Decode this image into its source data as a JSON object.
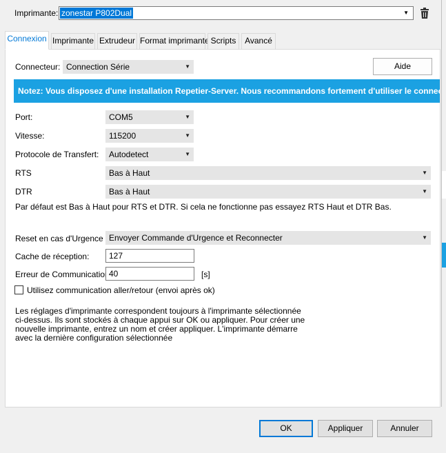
{
  "printer": {
    "label": "Imprimante:",
    "selected": "zonestar P802Dual"
  },
  "tabs": [
    "Connexion",
    "Imprimante",
    "Extrudeur",
    "Format imprimante",
    "Scripts",
    "Avancé"
  ],
  "connection": {
    "connector_label": "Connecteur:",
    "connector_value": "Connection Série",
    "help_label": "Aide",
    "notice": "Notez: Vous disposez d'une installation Repetier-Server. Nous recommandons fortement d'utiliser le connect",
    "port_label": "Port:",
    "port_value": "COM5",
    "speed_label": "Vitesse:",
    "speed_value": "115200",
    "protocol_label": "Protocole de Transfert:",
    "protocol_value": "Autodetect",
    "rts_label": "RTS",
    "rts_value": "Bas à Haut",
    "dtr_label": "DTR",
    "dtr_value": "Bas à Haut",
    "rts_dtr_hint": "Par défaut est Bas à Haut pour RTS et DTR. Si cela ne fonctionne pas essayez RTS Haut et DTR Bas.",
    "reset_label": "Reset en cas d'Urgence",
    "reset_value": "Envoyer Commande d'Urgence et Reconnecter",
    "cache_label": "Cache de réception:",
    "cache_value": "127",
    "error_label": "Erreur de Communication:",
    "error_value": "40",
    "error_unit": "[s]",
    "pingpong_label": "Utilisez communication aller/retour (envoi après ok)",
    "pingpong_checked": false,
    "info_lines": [
      "Les réglages d'imprimante correspondent toujours à l'imprimante sélectionnée",
      "ci-dessus. Ils sont stockés à chaque appui sur OK ou appliquer. Pour créer une",
      "nouvelle imprimante, entrez un nom et créer appliquer. L'imprimante démarre",
      "avec la dernière configuration sélectionnée"
    ]
  },
  "buttons": {
    "ok": "OK",
    "apply": "Appliquer",
    "cancel": "Annuler"
  },
  "colors": {
    "accent": "#0078d7",
    "notice_bg": "#1ba1e2",
    "selection": "#0078d7"
  }
}
